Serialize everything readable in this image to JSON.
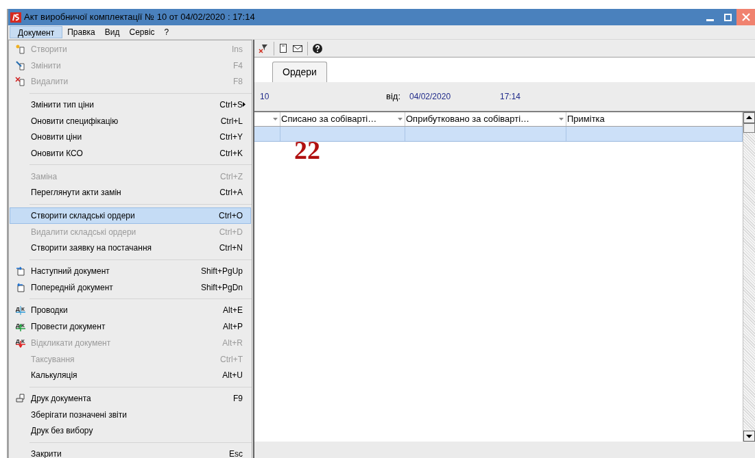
{
  "window": {
    "title": "Акт виробничої комплектації № 10 от 04/02/2020 : 17:14"
  },
  "menu_bar": [
    {
      "label": "Документ",
      "selected": true
    },
    {
      "label": "Правка",
      "selected": false
    },
    {
      "label": "Вид",
      "selected": false
    },
    {
      "label": "Сервіс",
      "selected": false
    },
    {
      "label": "?",
      "selected": false
    }
  ],
  "menu": [
    [
      {
        "kind": "new",
        "label": "Створити",
        "shortcut": "Ins",
        "disabled": true,
        "selected": false
      },
      {
        "kind": "edit",
        "label": "Змінити",
        "shortcut": "F4",
        "disabled": true,
        "selected": false
      },
      {
        "kind": "delete",
        "label": "Видалити",
        "shortcut": "F8",
        "disabled": true,
        "selected": false
      }
    ],
    [
      {
        "label": "Змінити тип ціни",
        "shortcut": "Ctrl+S",
        "submenu": true,
        "disabled": false,
        "selected": false
      },
      {
        "label": "Оновити специфікацію",
        "shortcut": "Ctrl+L",
        "disabled": false,
        "selected": false
      },
      {
        "label": "Оновити ціни",
        "shortcut": "Ctrl+Y",
        "disabled": false,
        "selected": false
      },
      {
        "label": "Оновити КСО",
        "shortcut": "Ctrl+K",
        "disabled": false,
        "selected": false
      }
    ],
    [
      {
        "label": "Заміна",
        "shortcut": "Ctrl+Z",
        "disabled": true,
        "selected": false
      },
      {
        "label": "Переглянути акти замін",
        "shortcut": "Ctrl+A",
        "disabled": false,
        "selected": false
      }
    ],
    [
      {
        "label": "Створити складські ордери",
        "shortcut": "Ctrl+O",
        "disabled": false,
        "selected": true
      },
      {
        "label": "Видалити складські ордери",
        "shortcut": "Ctrl+D",
        "disabled": true,
        "selected": false
      },
      {
        "label": "Створити заявку на постачання",
        "shortcut": "Ctrl+N",
        "disabled": false,
        "selected": false
      }
    ],
    [
      {
        "kind": "next",
        "label": "Наступний документ",
        "shortcut": "Shift+PgUp",
        "disabled": false,
        "selected": false
      },
      {
        "kind": "prev",
        "label": "Попередній документ",
        "shortcut": "Shift+PgDn",
        "disabled": false,
        "selected": false
      }
    ],
    [
      {
        "kind": "ledger",
        "icon_letters": [
          "Д",
          "К"
        ],
        "label": "Проводки",
        "shortcut": "Alt+E",
        "disabled": false,
        "selected": false
      },
      {
        "kind": "post",
        "icon_letters": [
          "Д",
          "К"
        ],
        "label": "Провести документ",
        "shortcut": "Alt+P",
        "disabled": false,
        "selected": false
      },
      {
        "kind": "recall",
        "icon_letters": [
          "Д",
          "К"
        ],
        "label": "Відкликати документ",
        "shortcut": "Alt+R",
        "disabled": true,
        "selected": false
      },
      {
        "label": "Таксування",
        "shortcut": "Ctrl+T",
        "disabled": true,
        "selected": false
      },
      {
        "label": "Калькуляція",
        "shortcut": "Alt+U",
        "disabled": false,
        "selected": false
      }
    ],
    [
      {
        "kind": "print",
        "label": "Друк документа",
        "shortcut": "F9",
        "disabled": false,
        "selected": false
      },
      {
        "label": "Зберігати позначені звіти",
        "disabled": false,
        "selected": false
      },
      {
        "label": "Друк без вибору",
        "disabled": false,
        "selected": false
      }
    ],
    [
      {
        "label": "Закрити",
        "shortcut": "Esc",
        "disabled": false,
        "selected": false
      }
    ]
  ],
  "tabs": [
    {
      "label": "Ордери",
      "selected": true
    }
  ],
  "header": {
    "number": "10",
    "date_label": "від:",
    "date": "04/02/2020",
    "time": "17:14"
  },
  "table": {
    "columns": [
      "",
      "Списано за собіварті…",
      "Оприбутковано за собіварті…",
      "Примітка"
    ],
    "rows": [
      {
        "selected": true
      }
    ]
  },
  "annotation": "22"
}
